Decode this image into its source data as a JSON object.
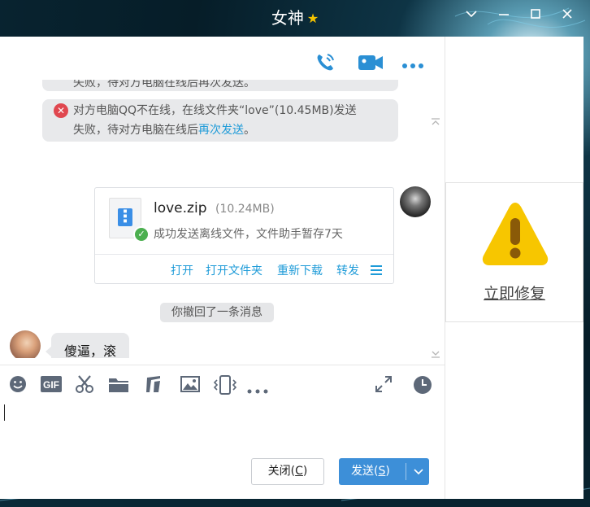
{
  "window": {
    "title": "女神",
    "title_star": "★"
  },
  "messages": {
    "system_partial": "失败，待对方电脑在线后再次发送。",
    "system_full_line1": "对方电脑QQ不在线，在线文件夹“love”(10.45MB)发送",
    "system_full_line2_prefix": "失败，待对方电脑在线后",
    "system_full_link": "再次发送",
    "system_full_suffix": "。",
    "file": {
      "name": "love.zip",
      "size": "(10.24MB)",
      "status": "成功发送离线文件，文件助手暂存7天",
      "actions": [
        "打开",
        "打开文件夹",
        "重新下载",
        "转发"
      ]
    },
    "recall_notice": "你撤回了一条消息",
    "incoming_text": "傻逼，滚"
  },
  "footer": {
    "close_label": "关闭(",
    "close_key": "C",
    "close_tail": ")",
    "send_label": "发送(",
    "send_key": "S",
    "send_tail": ")"
  },
  "side": {
    "fix_label": "立即修复"
  },
  "colors": {
    "accent": "#3d8fd8",
    "link": "#1e9bd8",
    "warning": "#f7c600",
    "error": "#e0474f",
    "success": "#4caf50"
  }
}
